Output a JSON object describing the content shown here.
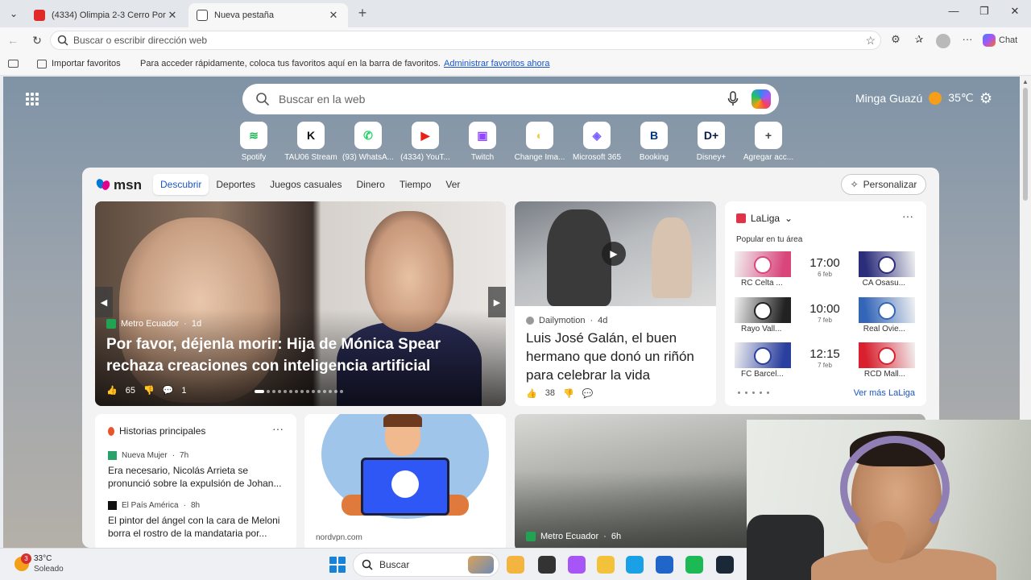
{
  "tabs": [
    {
      "title": "(4334) Olimpia 2-3 Cerro Porteño",
      "favicon": "youtube-icon"
    },
    {
      "title": "Nueva pestaña",
      "favicon": "new-tab-page-icon"
    }
  ],
  "address_bar": {
    "placeholder": "Buscar o escribir dirección web"
  },
  "toolbar": {
    "chat_label": "Chat"
  },
  "favorites_bar": {
    "import_label": "Importar favoritos",
    "message": "Para acceder rápidamente, coloca tus favoritos aquí en la barra de favoritos.",
    "manage_link": "Administrar favoritos ahora"
  },
  "ntp": {
    "search_placeholder": "Buscar en la web",
    "weather": {
      "location": "Minga Guazú",
      "temp": "35℃"
    },
    "quick_links": [
      {
        "label": "Spotify",
        "icon": "spotify-icon",
        "color": "#1db954",
        "glyph": "≋"
      },
      {
        "label": "TAU06 Stream",
        "icon": "kick-icon",
        "color": "#111111",
        "glyph": "K"
      },
      {
        "label": "(93) WhatsA...",
        "icon": "whatsapp-icon",
        "color": "#25d366",
        "glyph": "✆"
      },
      {
        "label": "(4334) YouT...",
        "icon": "youtube-icon",
        "color": "#e62117",
        "glyph": "▶"
      },
      {
        "label": "Twitch",
        "icon": "twitch-icon",
        "color": "#9146ff",
        "glyph": "▣"
      },
      {
        "label": "Change Ima...",
        "icon": "change-image-icon",
        "color": "#f2c94c",
        "glyph": "◐"
      },
      {
        "label": "Microsoft 365",
        "icon": "microsoft-365-icon",
        "color": "#7b61ff",
        "glyph": "◈"
      },
      {
        "label": "Booking",
        "icon": "booking-icon",
        "color": "#003580",
        "glyph": "B"
      },
      {
        "label": "Disney+",
        "icon": "disney-plus-icon",
        "color": "#0a1a4a",
        "glyph": "D+"
      },
      {
        "label": "Agregar acc...",
        "icon": "add-shortcut-icon",
        "color": "#444444",
        "glyph": "+"
      }
    ]
  },
  "feed": {
    "brand": "msn",
    "nav": [
      "Descubrir",
      "Deportes",
      "Juegos casuales",
      "Dinero",
      "Tiempo",
      "Ver"
    ],
    "personalize": "Personalizar",
    "hero": {
      "source": "Metro Ecuador",
      "age": "1d",
      "headline": "Por favor, déjenla morir: Hija de Mónica Spear rechaza creaciones con inteligencia artificial",
      "likes": "65",
      "comments": "1"
    },
    "card2": {
      "source": "Dailymotion",
      "age": "4d",
      "headline": "Luis José Galán, el buen hermano que donó un riñón para celebrar la vida",
      "likes": "38"
    },
    "laliga": {
      "title": "LaLiga",
      "subtitle": "Popular en tu área",
      "matches": [
        {
          "home": "RC Celta ...",
          "away": "CA Osasu...",
          "time": "17:00",
          "date": "6 feb",
          "home_color": "#d8467a",
          "away_color": "#2b2d7a"
        },
        {
          "home": "Rayo Vall...",
          "away": "Real Ovie...",
          "time": "10:00",
          "date": "7 feb",
          "home_color": "#222222",
          "away_color": "#3466b8"
        },
        {
          "home": "FC Barcel...",
          "away": "RCD Mall...",
          "time": "12:15",
          "date": "7 feb",
          "home_color": "#2b3f9e",
          "away_color": "#d8202e"
        }
      ],
      "see_more": "Ver más LaLiga"
    },
    "top_stories": {
      "title": "Historias principales",
      "items": [
        {
          "source": "Nueva Mujer",
          "age": "7h",
          "text": "Era necesario, Nicolás Arrieta se pronunció sobre la expulsión de Johan..."
        },
        {
          "source": "El País América",
          "age": "8h",
          "text": "El pintor del ángel con la cara de Meloni borra el rostro de la mandataria por..."
        }
      ]
    },
    "ad": {
      "url": "nordvpn.com"
    },
    "video": {
      "source": "Metro Ecuador",
      "age": "6h"
    }
  },
  "taskbar": {
    "weather": {
      "temp": "33°C",
      "condition": "Soleado",
      "badge": "3"
    },
    "search_label": "Buscar",
    "apps": [
      {
        "name": "file-explorer-icon",
        "color": "#f3b53f"
      },
      {
        "name": "terminal-icon",
        "color": "#333333"
      },
      {
        "name": "copilot-icon",
        "color": "#a855f7"
      },
      {
        "name": "folder-icon",
        "color": "#f3c13a"
      },
      {
        "name": "edge-icon",
        "color": "#1aa0e6"
      },
      {
        "name": "store-icon",
        "color": "#2065c9"
      },
      {
        "name": "spotify-icon",
        "color": "#1db954"
      },
      {
        "name": "steam-icon",
        "color": "#1b2838"
      }
    ]
  }
}
